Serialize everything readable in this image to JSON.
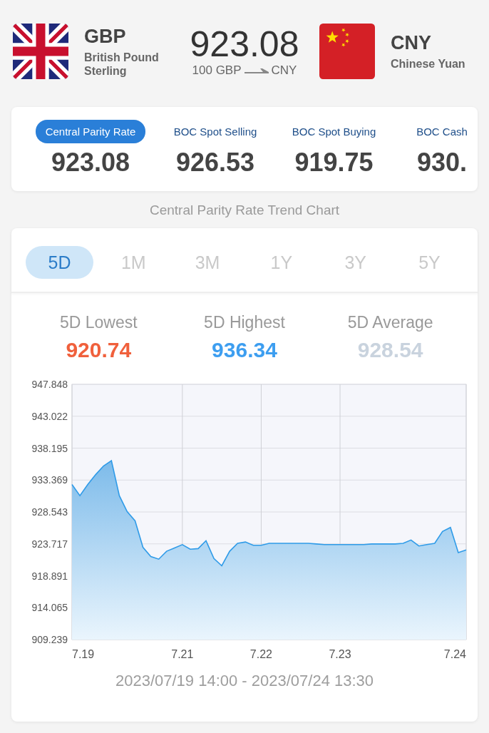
{
  "pair": {
    "base": {
      "code": "GBP",
      "name": "British Pound Sterling"
    },
    "rate": "923.08",
    "conversion": {
      "from": "100 GBP",
      "to": "CNY"
    },
    "quote": {
      "code": "CNY",
      "name": "Chinese Yuan"
    }
  },
  "rates": [
    {
      "label": "Central Parity Rate",
      "value": "923.08",
      "selected": true
    },
    {
      "label": "BOC Spot Selling",
      "value": "926.53",
      "selected": false
    },
    {
      "label": "BOC Spot Buying",
      "value": "919.75",
      "selected": false
    },
    {
      "label": "BOC Cash",
      "value": "930.",
      "selected": false
    }
  ],
  "chart_title": "Central Parity Rate Trend Chart",
  "periods": [
    {
      "label": "5D",
      "selected": true
    },
    {
      "label": "1M",
      "selected": false
    },
    {
      "label": "3M",
      "selected": false
    },
    {
      "label": "1Y",
      "selected": false
    },
    {
      "label": "3Y",
      "selected": false
    },
    {
      "label": "5Y",
      "selected": false
    }
  ],
  "stats": [
    {
      "label": "5D Lowest",
      "value": "920.74",
      "color": "#f0603c"
    },
    {
      "label": "5D Highest",
      "value": "936.34",
      "color": "#3d9ef0"
    },
    {
      "label": "5D Average",
      "value": "928.54",
      "color": "#c9d3de"
    }
  ],
  "chart_data": {
    "type": "area",
    "categories": [
      "7.19",
      null,
      null,
      null,
      null,
      null,
      null,
      null,
      null,
      null,
      null,
      null,
      null,
      null,
      "7.21",
      null,
      null,
      null,
      null,
      null,
      null,
      null,
      null,
      null,
      "7.22",
      null,
      null,
      null,
      null,
      null,
      null,
      null,
      null,
      null,
      "7.23",
      null,
      null,
      null,
      null,
      null,
      null,
      null,
      null,
      null,
      null,
      null,
      null,
      null,
      null,
      null,
      "7.24"
    ],
    "series": [
      {
        "color": "#2f9be8",
        "values": [
          932.7,
          931.0,
          932.7,
          934.2,
          935.5,
          936.3,
          931.0,
          928.6,
          927.2,
          923.2,
          921.8,
          921.4,
          922.6,
          923.1,
          923.6,
          922.9,
          923.0,
          924.2,
          921.5,
          920.4,
          922.6,
          923.8,
          924.0,
          923.5,
          923.5,
          923.8,
          923.8,
          923.8,
          923.8,
          923.8,
          923.8,
          923.7,
          923.6,
          923.6,
          923.6,
          923.6,
          923.6,
          923.6,
          923.7,
          923.7,
          923.7,
          923.7,
          923.8,
          924.3,
          923.4,
          923.6,
          923.8,
          925.6,
          926.2,
          922.4,
          922.8
        ]
      }
    ],
    "grid": true,
    "ylim": [
      909.239,
      947.848
    ],
    "yticks": [
      909.239,
      914.065,
      918.891,
      923.717,
      928.543,
      933.369,
      938.195,
      943.022,
      947.848
    ]
  },
  "range": "2023/07/19 14:00 - 2023/07/24 13:30"
}
